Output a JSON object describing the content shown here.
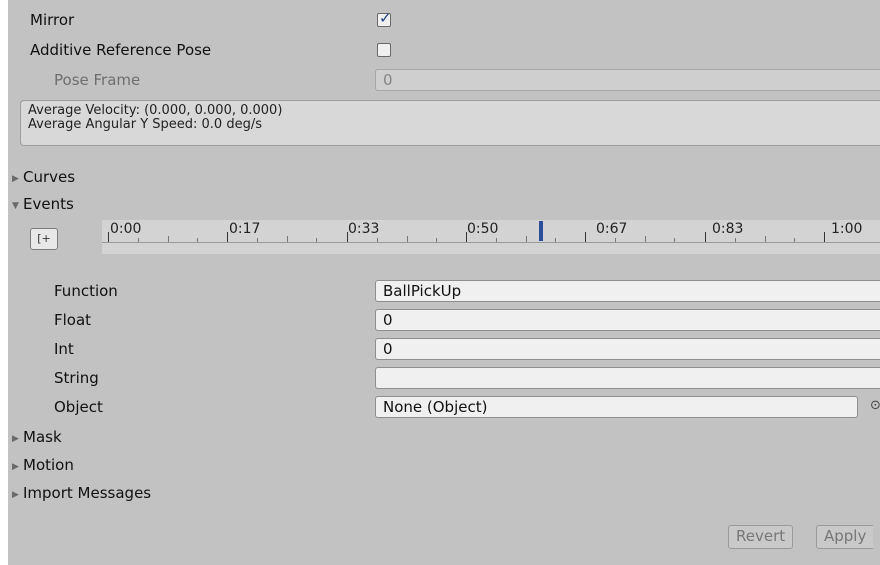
{
  "mirror": {
    "label": "Mirror",
    "checked": true
  },
  "additive_reference_pose": {
    "label": "Additive Reference Pose",
    "checked": false
  },
  "pose_frame": {
    "label": "Pose Frame",
    "value": "0"
  },
  "help_box": {
    "line1": "Average Velocity: (0.000, 0.000, 0.000)",
    "line2": "Average Angular Y Speed: 0.0 deg/s"
  },
  "foldouts": {
    "curves": "Curves",
    "events": "Events",
    "mask": "Mask",
    "motion": "Motion",
    "import_messages": "Import Messages"
  },
  "timeline": {
    "add_event_icon": "add-event-icon",
    "labels": [
      "0:00",
      "0:17",
      "0:33",
      "0:50",
      "0:67",
      "0:83",
      "1:00"
    ]
  },
  "event": {
    "function": {
      "label": "Function",
      "value": "BallPickUp"
    },
    "float": {
      "label": "Float",
      "value": "0"
    },
    "int": {
      "label": "Int",
      "value": "0"
    },
    "string": {
      "label": "String",
      "value": ""
    },
    "object": {
      "label": "Object",
      "value": "None (Object)",
      "picker_icon": "object-picker-icon"
    }
  },
  "buttons": {
    "revert": "Revert",
    "apply": "Apply"
  },
  "colors": {
    "panel_bg": "#c2c2c2",
    "checkbox_tick": "#1d3c8a",
    "event_marker": "#2a4f9a"
  }
}
